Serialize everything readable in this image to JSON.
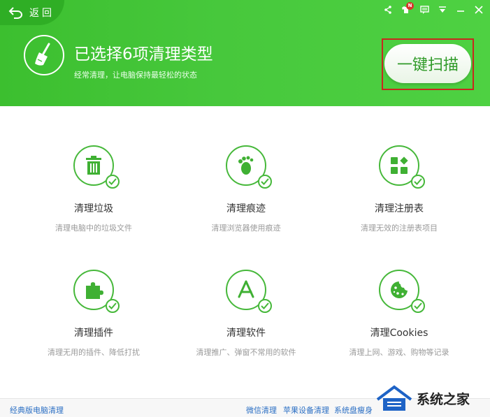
{
  "header": {
    "back_label": "返回",
    "title": "已选择6项清理类型",
    "subtitle": "经常清理，让电脑保持最轻松的状态",
    "scan_button": "一键扫描",
    "notification_badge": "N",
    "accent_color": "#46c43a"
  },
  "features": [
    {
      "name": "清理垃圾",
      "desc": "清理电脑中的垃圾文件",
      "icon": "trash-icon"
    },
    {
      "name": "清理痕迹",
      "desc": "清理浏览器使用痕迹",
      "icon": "footprint-icon"
    },
    {
      "name": "清理注册表",
      "desc": "清理无效的注册表项目",
      "icon": "registry-icon"
    },
    {
      "name": "清理插件",
      "desc": "清理无用的插件、降低打扰",
      "icon": "puzzle-icon"
    },
    {
      "name": "清理软件",
      "desc": "清理推广、弹窗不常用的软件",
      "icon": "app-icon"
    },
    {
      "name": "清理Cookies",
      "desc": "清理上网、游戏、购物等记录",
      "icon": "cookie-icon"
    }
  ],
  "footer": {
    "classic_link": "经典版电脑清理",
    "wechat_link": "微信清理",
    "apple_link": "苹果设备清理",
    "system_link": "系统盘瘦身"
  },
  "watermark": {
    "text": "系统之家"
  }
}
